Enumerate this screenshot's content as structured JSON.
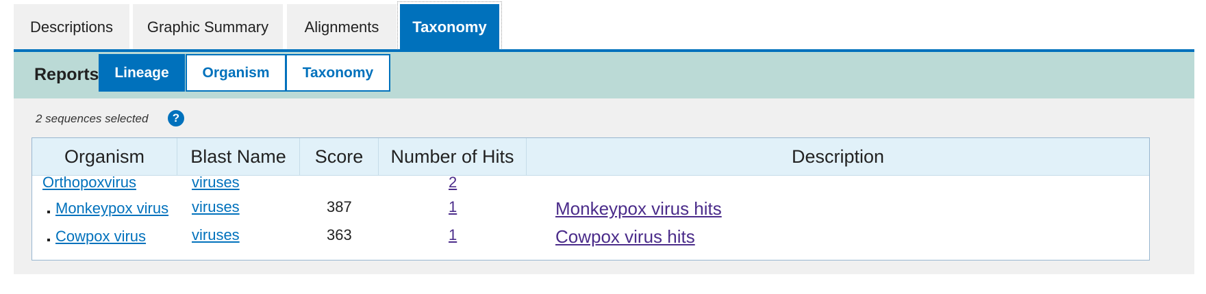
{
  "tabs": {
    "descriptions": "Descriptions",
    "graphic_summary": "Graphic Summary",
    "alignments": "Alignments",
    "taxonomy": "Taxonomy"
  },
  "reports": {
    "label": "Reports",
    "lineage": "Lineage",
    "organism": "Organism",
    "taxonomy": "Taxonomy"
  },
  "selection": {
    "text": "2 sequences selected",
    "help_icon": "question-circle-icon",
    "help_glyph": "?"
  },
  "table": {
    "headers": {
      "organism": "Organism",
      "blast_name": "Blast Name",
      "score": "Score",
      "hits": "Number of Hits",
      "description": "Description"
    },
    "rows": [
      {
        "organism": "Orthopoxvirus",
        "blast_name": "viruses",
        "score": "",
        "hits": "2",
        "description": ""
      },
      {
        "organism": "Monkeypox virus",
        "blast_name": "viruses",
        "score": "387",
        "hits": "1",
        "description": "Monkeypox virus hits"
      },
      {
        "organism": "Cowpox virus",
        "blast_name": "viruses",
        "score": "363",
        "hits": "1",
        "description": "Cowpox virus hits"
      }
    ]
  },
  "colors": {
    "accent": "#0071bc",
    "reports_bar": "#bbdad6",
    "panel_bg": "#f0f0f0",
    "table_header_bg": "#e1f1f9",
    "visited_link": "#4b2c8a"
  }
}
